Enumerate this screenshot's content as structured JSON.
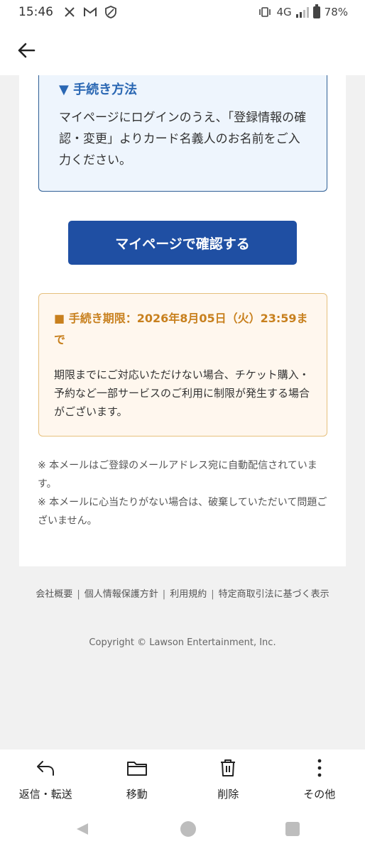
{
  "status_bar": {
    "time": "15:46",
    "network": "4G",
    "battery": "78%"
  },
  "app_bar": {
    "back_icon": "arrow-left-icon"
  },
  "procedure": {
    "title": "▼ 手続き方法",
    "body": "マイページにログインのうえ、「登録情報の確認・変更」よりカード名義人のお名前をご入力ください。"
  },
  "mypage_button": {
    "label": "マイページで確認する"
  },
  "deadline": {
    "title": "■ 手続き期限：2026年8月05日（火）23:59まで",
    "body": "期限までにご対応いただけない場合、チケット購入・予約など一部サービスのご利用に制限が発生する場合がございます。"
  },
  "notes": [
    "※ 本メールはご登録のメールアドレス宛に自動配信されています。",
    "※ 本メールに心当たりがない場合は、破棄していただいて問題ございません。"
  ],
  "footer": {
    "links": [
      "会社概要",
      "個人情報保護方針",
      "利用規約",
      "特定商取引法に基づく表示"
    ],
    "separator": "|",
    "copyright": "Copyright © Lawson Entertainment, Inc."
  },
  "actions": [
    {
      "label": "返信・転送",
      "icon": "reply-icon"
    },
    {
      "label": "移動",
      "icon": "folder-icon"
    },
    {
      "label": "削除",
      "icon": "trash-icon"
    },
    {
      "label": "その他",
      "icon": "more-vertical-icon"
    }
  ],
  "colors": {
    "button_blue": "#1f4fa3",
    "procedure_title": "#2a67b3",
    "deadline_orange": "#c8801e",
    "deadline_bg": "#fff7ee",
    "procedure_bg": "#eef5fd"
  }
}
